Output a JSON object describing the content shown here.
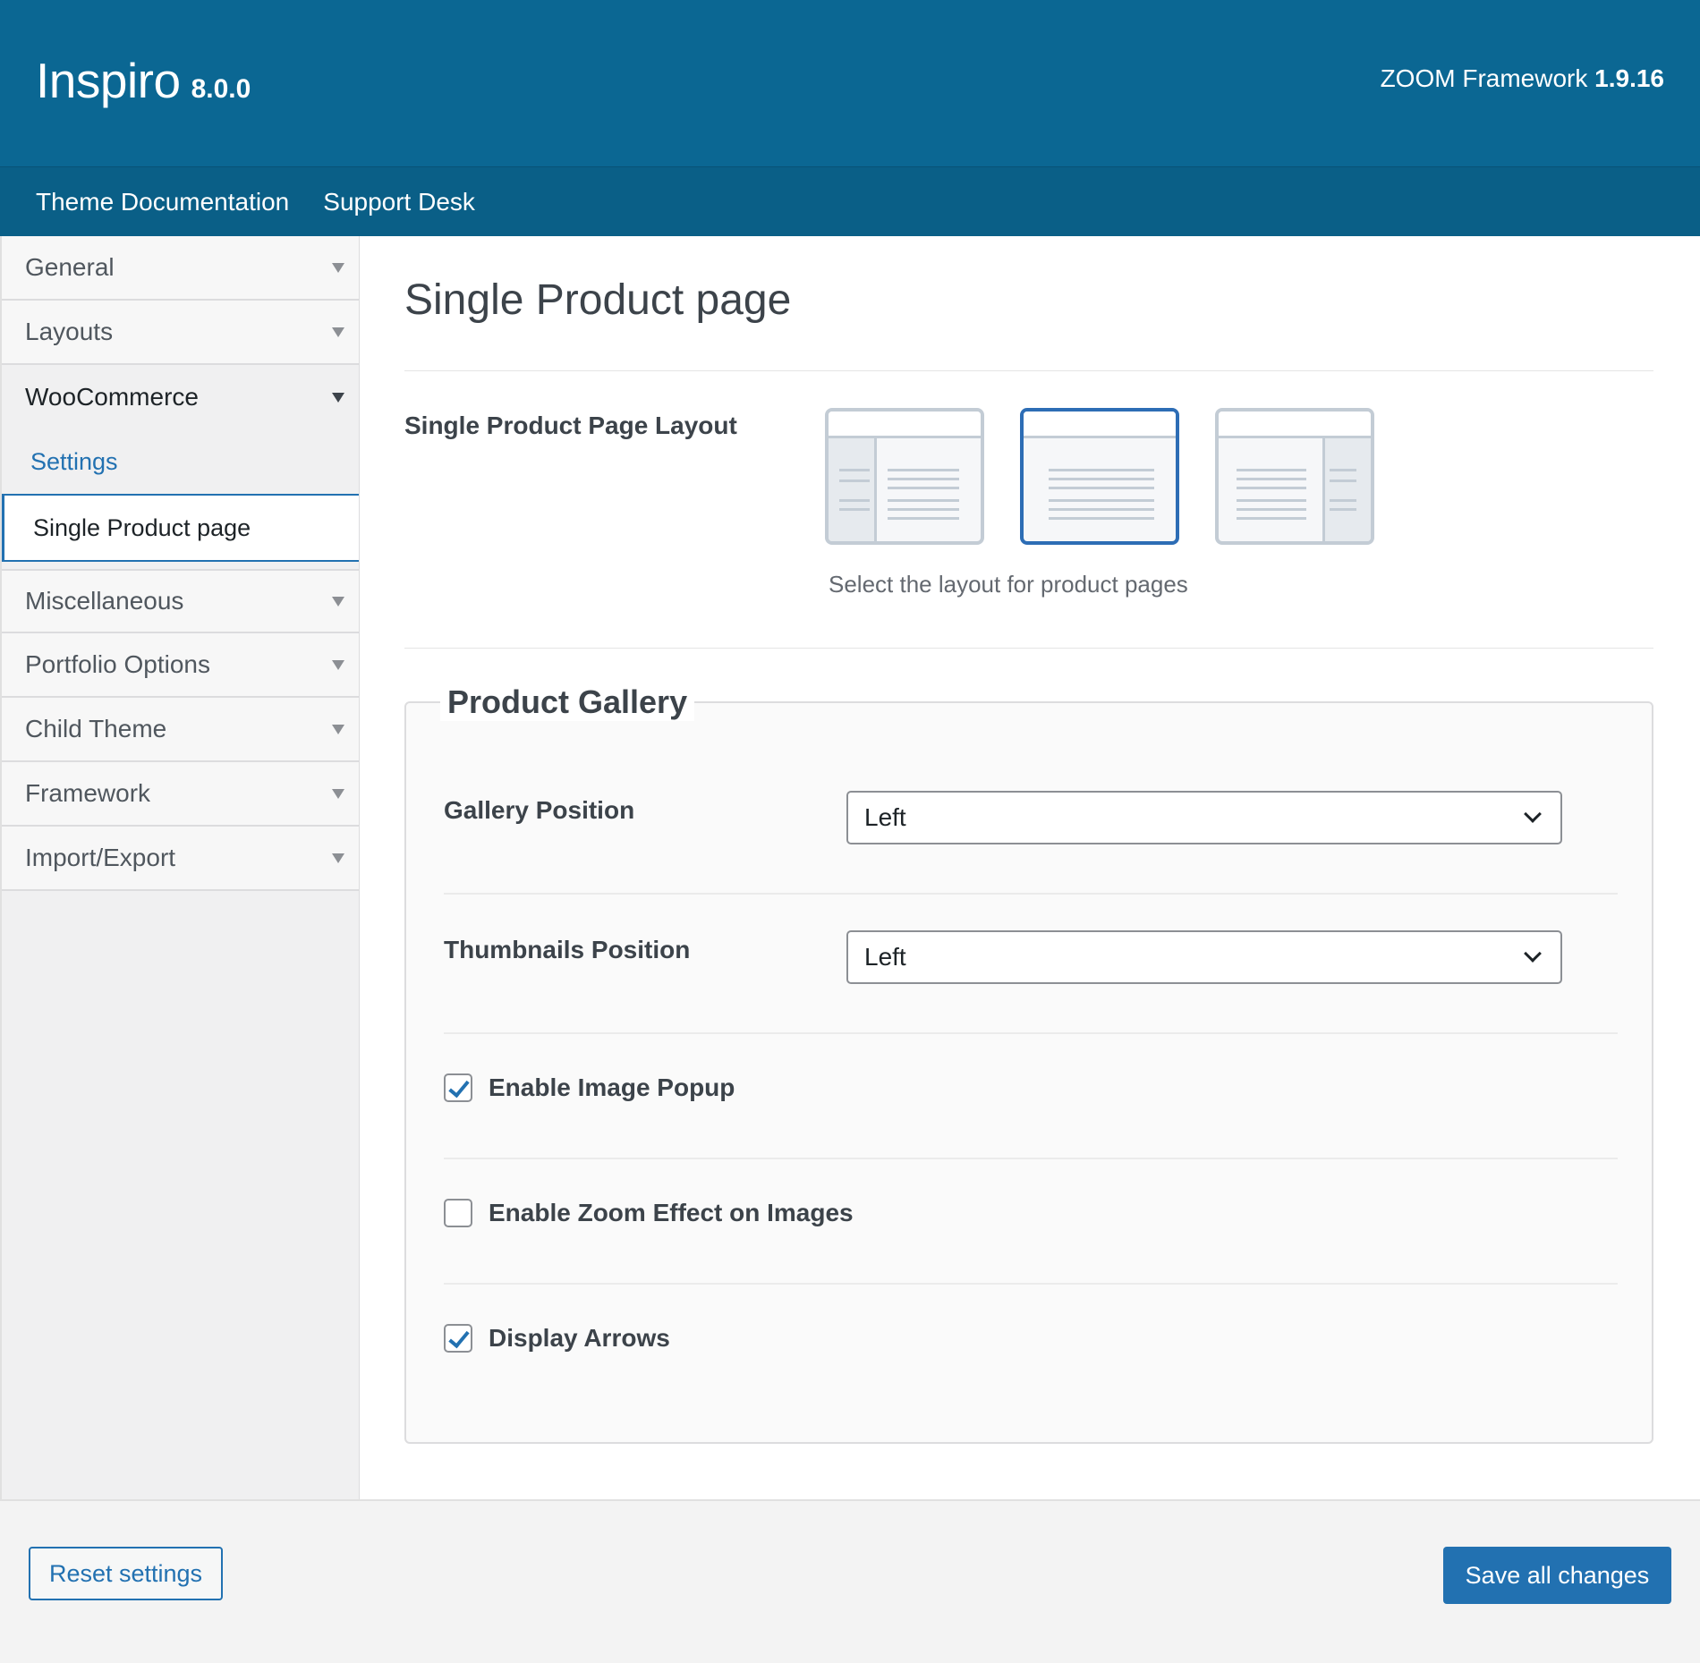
{
  "header": {
    "brand_name": "Inspiro",
    "brand_version": "8.0.0",
    "framework_label": "ZOOM Framework",
    "framework_version": "1.9.16"
  },
  "topnav": {
    "items": [
      "Theme Documentation",
      "Support Desk"
    ]
  },
  "sidebar": {
    "items": [
      {
        "label": "General"
      },
      {
        "label": "Layouts"
      },
      {
        "label": "WooCommerce"
      },
      {
        "label": "Miscellaneous"
      },
      {
        "label": "Portfolio Options"
      },
      {
        "label": "Child Theme"
      },
      {
        "label": "Framework"
      },
      {
        "label": "Import/Export"
      }
    ],
    "woocommerce_sub": {
      "settings": "Settings",
      "active": "Single Product page"
    }
  },
  "main": {
    "title": "Single Product page",
    "layout": {
      "label": "Single Product Page Layout",
      "hint": "Select the layout for product pages",
      "selected_index": 1
    },
    "gallery": {
      "legend": "Product Gallery",
      "gallery_position_label": "Gallery Position",
      "gallery_position_value": "Left",
      "thumbnails_position_label": "Thumbnails Position",
      "thumbnails_position_value": "Left",
      "checks": [
        {
          "label": "Enable Image Popup",
          "checked": true
        },
        {
          "label": "Enable Zoom Effect on Images",
          "checked": false
        },
        {
          "label": "Display Arrows",
          "checked": true
        }
      ]
    }
  },
  "footer": {
    "reset_label": "Reset settings",
    "save_label": "Save all changes"
  },
  "colors": {
    "header": "#0b6793",
    "accent": "#2271b1"
  }
}
